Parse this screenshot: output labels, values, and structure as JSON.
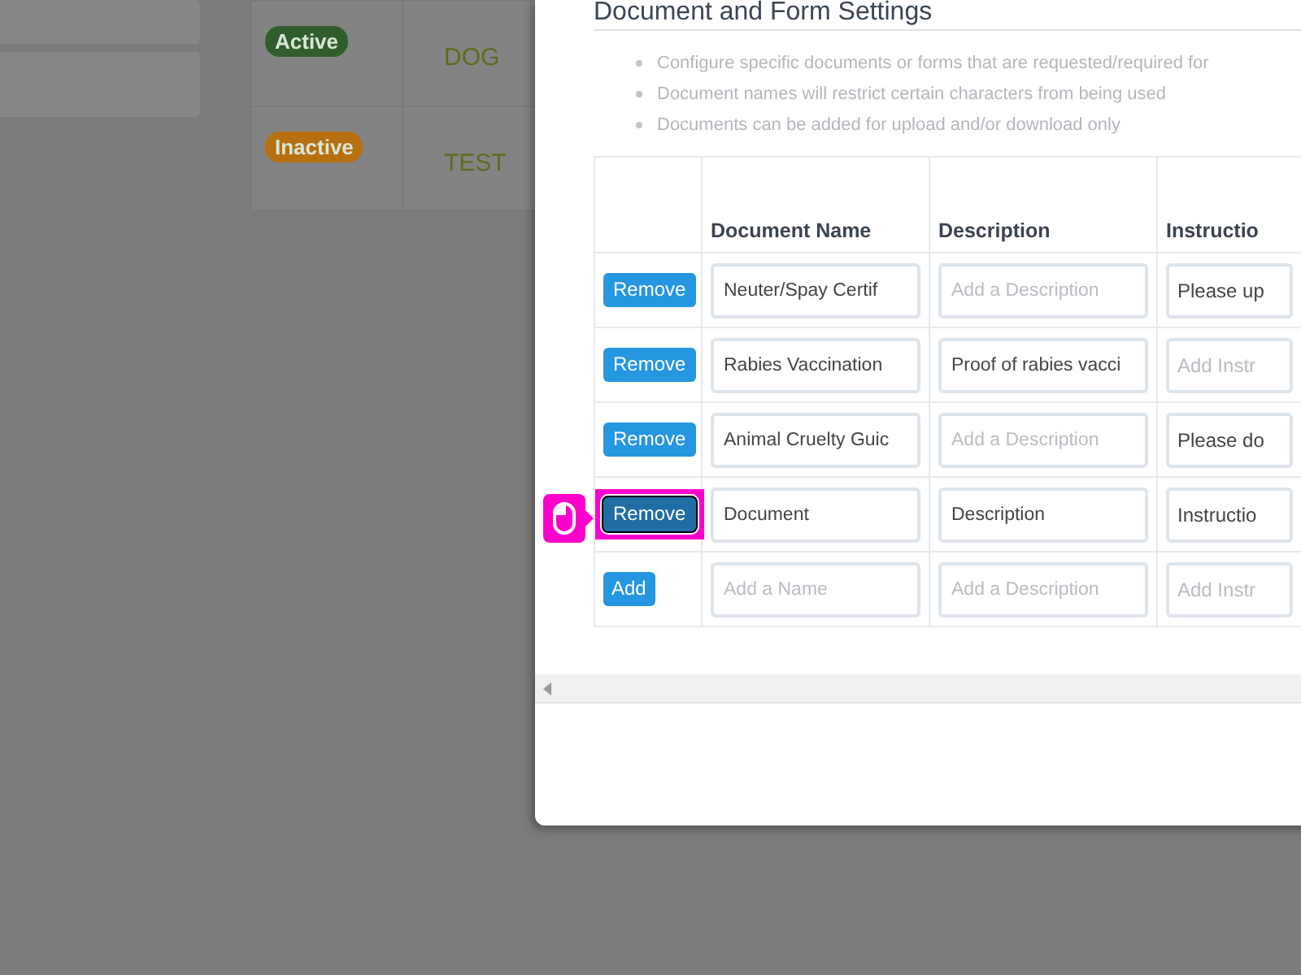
{
  "background": {
    "rows": [
      {
        "status": {
          "label": "Active",
          "color": "#2f5e2c"
        },
        "name": "DOG"
      },
      {
        "status": {
          "label": "Inactive",
          "color": "#b7700f"
        },
        "name": "TEST"
      }
    ]
  },
  "modal": {
    "title": "Document and Form Settings",
    "notes": [
      "Configure specific documents or forms that are requested/required for",
      "Document names will restrict certain characters from being used",
      "Documents can be added for upload and/or download only"
    ],
    "table": {
      "columns": [
        "Document Name",
        "Description",
        "Instructio"
      ],
      "rows": [
        {
          "kind": "existing",
          "button": "Remove",
          "focused": false,
          "cells": [
            {
              "value": "Neuter/Spay Certif"
            },
            {
              "placeholder": "Add a Description"
            },
            {
              "value": "Please up"
            }
          ]
        },
        {
          "kind": "existing",
          "button": "Remove",
          "focused": false,
          "cells": [
            {
              "value": "Rabies Vaccination"
            },
            {
              "value": "Proof of rabies vacci"
            },
            {
              "placeholder": "Add Instr"
            }
          ]
        },
        {
          "kind": "existing",
          "button": "Remove",
          "focused": false,
          "cells": [
            {
              "value": "Animal Cruelty Guic"
            },
            {
              "placeholder": "Add a Description"
            },
            {
              "value": "Please do"
            }
          ]
        },
        {
          "kind": "existing",
          "button": "Remove",
          "focused": true,
          "cells": [
            {
              "value": "Document"
            },
            {
              "value": "Description"
            },
            {
              "value": "Instructio"
            }
          ]
        },
        {
          "kind": "new",
          "button": "Add",
          "focused": false,
          "cells": [
            {
              "placeholder": "Add a Name"
            },
            {
              "placeholder": "Add a Description"
            },
            {
              "placeholder": "Add Instr"
            }
          ]
        }
      ]
    }
  }
}
